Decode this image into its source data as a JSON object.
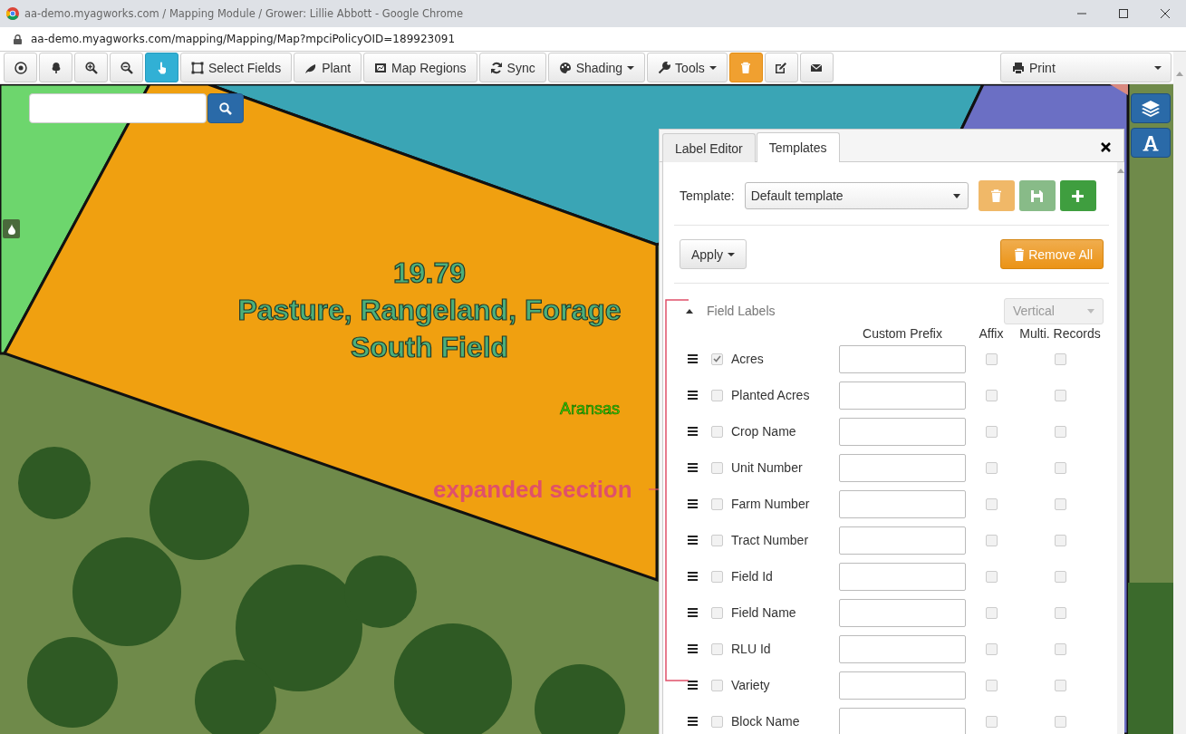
{
  "browser": {
    "title": "aa-demo.myagworks.com / Mapping Module / Grower: Lillie Abbott - Google Chrome",
    "url": "aa-demo.myagworks.com/mapping/Mapping/Map?mpciPolicyOID=189923091"
  },
  "toolbar": {
    "buttons": [
      {
        "kind": "default",
        "selected": false
      },
      {
        "kind": "default",
        "selected": false
      },
      {
        "kind": "default",
        "selected": false
      },
      {
        "kind": "default",
        "selected": false
      },
      {
        "kind": "default",
        "selected": true
      },
      {
        "kind": "default",
        "selected": false,
        "label": "Select Fields"
      },
      {
        "kind": "default",
        "selected": false,
        "label": "Plant"
      },
      {
        "kind": "default",
        "selected": false,
        "label": "Map Regions"
      },
      {
        "kind": "default",
        "selected": false,
        "label": "Sync"
      },
      {
        "kind": "default",
        "selected": false,
        "label": "Shading",
        "caret": true
      },
      {
        "kind": "default",
        "selected": false,
        "label": "Tools",
        "caret": true
      },
      {
        "kind": "warning",
        "selected": false
      },
      {
        "kind": "default",
        "selected": false
      },
      {
        "kind": "default",
        "selected": false
      }
    ],
    "print": {
      "label": "Print"
    }
  },
  "map": {
    "field_label": [
      "19.79",
      "Pasture, Rangeland, Forage",
      "South Field"
    ],
    "county_label": "Aransas",
    "annotation": "expanded section"
  },
  "panel": {
    "tabs": [
      {
        "label": "Label Editor",
        "selected": false
      },
      {
        "label": "Templates",
        "selected": true
      }
    ],
    "template_label": "Template:",
    "template_value": "Default template",
    "apply_button": "Apply",
    "remove_all_button": "Remove All",
    "section": {
      "title": "Field Labels",
      "expanded": true,
      "orientation": "Vertical",
      "columns": [
        "Custom Prefix",
        "Affix",
        "Multi. Records"
      ],
      "rows": [
        {
          "name": "Acres",
          "checked": true,
          "affix": false,
          "multi_records": false
        },
        {
          "name": "Planted Acres",
          "checked": false,
          "affix": false,
          "multi_records": false
        },
        {
          "name": "Crop Name",
          "checked": false,
          "affix": false,
          "multi_records": false
        },
        {
          "name": "Unit Number",
          "checked": false,
          "affix": false,
          "multi_records": false
        },
        {
          "name": "Farm Number",
          "checked": false,
          "affix": false,
          "multi_records": false
        },
        {
          "name": "Tract Number",
          "checked": false,
          "affix": false,
          "multi_records": false
        },
        {
          "name": "Field Id",
          "checked": false,
          "affix": false,
          "multi_records": false
        },
        {
          "name": "Field Name",
          "checked": false,
          "affix": false,
          "multi_records": false
        },
        {
          "name": "RLU Id",
          "checked": false,
          "affix": false,
          "multi_records": false
        },
        {
          "name": "Variety",
          "checked": false,
          "affix": false,
          "multi_records": false
        },
        {
          "name": "Block Name",
          "checked": false,
          "affix": false,
          "multi_records": false
        }
      ]
    }
  }
}
